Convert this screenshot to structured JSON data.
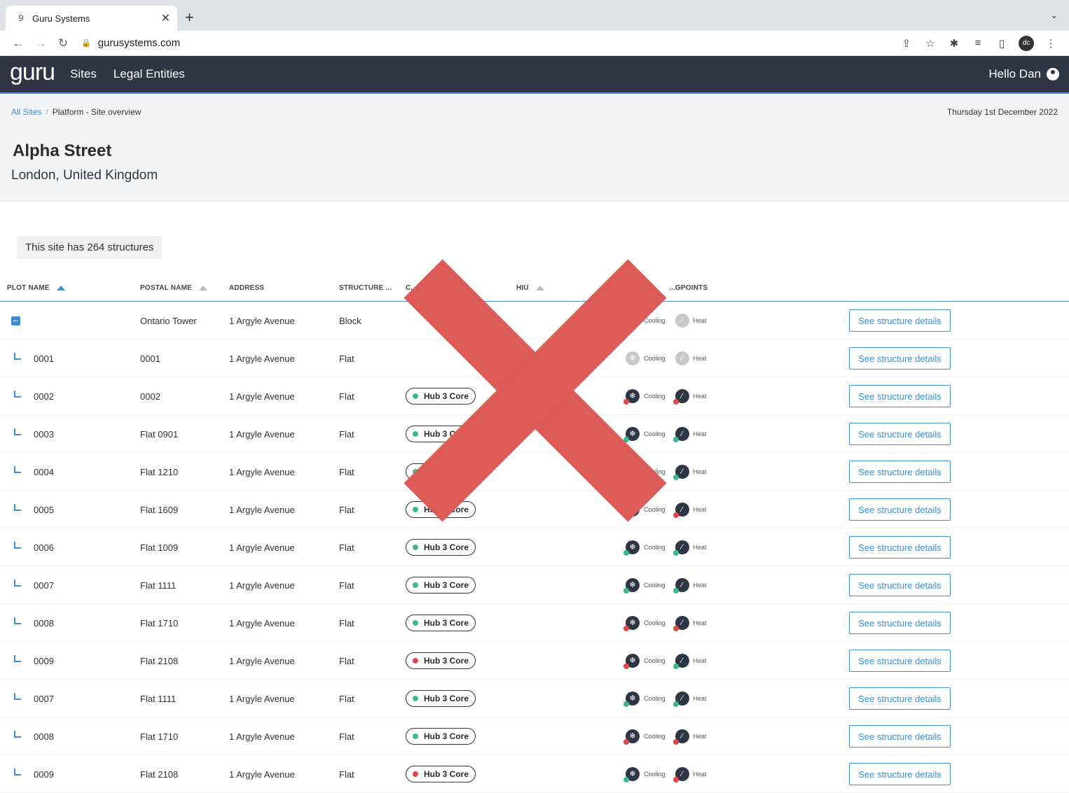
{
  "browser": {
    "tab_title": "Guru Systems",
    "tab_favicon": "9",
    "url": "gurusystems.com",
    "profile_initials": "dc"
  },
  "header": {
    "logo": "guru",
    "nav": [
      "Sites",
      "Legal Entities"
    ],
    "greeting": "Hello Dan"
  },
  "breadcrumb": {
    "link": "All Sites",
    "current": "Platform - Site overview"
  },
  "date": "Thursday 1st December 2022",
  "site": {
    "name": "Alpha Street",
    "location": "London, United Kingdom"
  },
  "structure_count": "This site has 264 structures",
  "columns": {
    "plot": "PLOT NAME",
    "postal": "POSTAL NAME",
    "address": "ADDRESS",
    "structure": "STRUCTURE ...",
    "comms": "C...",
    "hiu": "HIU",
    "metering": "...GPOINTS"
  },
  "labels": {
    "cooling": "Cooling",
    "heat": "Heat",
    "details_button": "See structure details"
  },
  "colors": {
    "accent": "#3a8fd6",
    "online": "#3db88a",
    "offline": "#e04848",
    "header_bg": "#2e3645"
  },
  "rows": [
    {
      "plot": "",
      "postal": "Ontario Tower",
      "address": "1 Argyle Avenue",
      "type": "Block",
      "hub": "",
      "hub_status": "",
      "cool": "grey",
      "heat": "grey",
      "parent": true
    },
    {
      "plot": "0001",
      "postal": "0001",
      "address": "1 Argyle Avenue",
      "type": "Flat",
      "hub": "",
      "hub_status": "",
      "cool": "grey",
      "heat": "grey"
    },
    {
      "plot": "0002",
      "postal": "0002",
      "address": "1 Argyle Avenue",
      "type": "Flat",
      "hub": "Hub 3 Core",
      "hub_status": "online",
      "cool": "offline",
      "heat": "offline"
    },
    {
      "plot": "0003",
      "postal": "Flat 0901",
      "address": "1 Argyle Avenue",
      "type": "Flat",
      "hub": "Hub 3 Core",
      "hub_status": "online",
      "cool": "online",
      "heat": "online"
    },
    {
      "plot": "0004",
      "postal": "Flat 1210",
      "address": "1 Argyle Avenue",
      "type": "Flat",
      "hub": "Hub 3 Core",
      "hub_status": "online",
      "cool": "online",
      "heat": "online"
    },
    {
      "plot": "0005",
      "postal": "Flat 1609",
      "address": "1 Argyle Avenue",
      "type": "Flat",
      "hub": "Hub 3 Core",
      "hub_status": "online",
      "cool": "offline",
      "heat": "offline"
    },
    {
      "plot": "0006",
      "postal": "Flat 1009",
      "address": "1 Argyle Avenue",
      "type": "Flat",
      "hub": "Hub 3 Core",
      "hub_status": "online",
      "cool": "online",
      "heat": "online"
    },
    {
      "plot": "0007",
      "postal": "Flat 1111",
      "address": "1 Argyle Avenue",
      "type": "Flat",
      "hub": "Hub 3 Core",
      "hub_status": "online",
      "cool": "online",
      "heat": "online"
    },
    {
      "plot": "0008",
      "postal": "Flat 1710",
      "address": "1 Argyle Avenue",
      "type": "Flat",
      "hub": "Hub 3 Core",
      "hub_status": "online",
      "cool": "offline",
      "heat": "offline"
    },
    {
      "plot": "0009",
      "postal": "Flat 2108",
      "address": "1 Argyle Avenue",
      "type": "Flat",
      "hub": "Hub 3 Core",
      "hub_status": "offline",
      "cool": "offline",
      "heat": "online"
    },
    {
      "plot": "0007",
      "postal": "Flat 1111",
      "address": "1 Argyle Avenue",
      "type": "Flat",
      "hub": "Hub 3 Core",
      "hub_status": "online",
      "cool": "online",
      "heat": "online"
    },
    {
      "plot": "0008",
      "postal": "Flat 1710",
      "address": "1 Argyle Avenue",
      "type": "Flat",
      "hub": "Hub 3 Core",
      "hub_status": "online",
      "cool": "offline",
      "heat": "offline"
    },
    {
      "plot": "0009",
      "postal": "Flat 2108",
      "address": "1 Argyle Avenue",
      "type": "Flat",
      "hub": "Hub 3 Core",
      "hub_status": "offline",
      "cool": "online",
      "heat": "offline"
    }
  ]
}
